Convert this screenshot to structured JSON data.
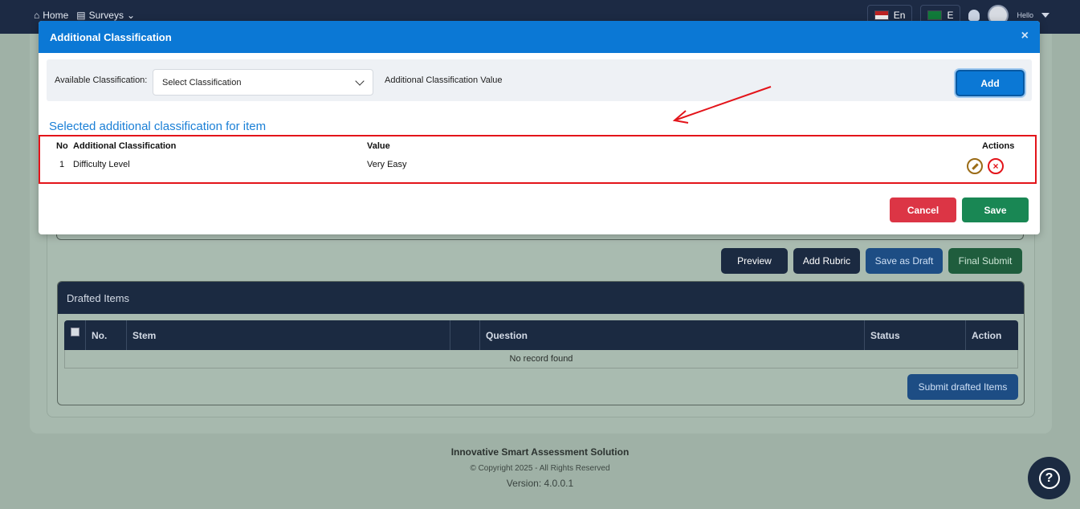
{
  "topbar": {
    "home_label": "Home",
    "surveys_label": "Surveys",
    "lang_label": "En",
    "lang2_label": "E",
    "greeting": "Hello"
  },
  "modal": {
    "title": "Additional Classification",
    "close_glyph": "×",
    "available_label": "Available Classification:",
    "select_value": "Select Classification",
    "value_label": "Additional Classification Value",
    "add_label": "Add",
    "section_title": "Selected additional classification for item",
    "table": {
      "headers": {
        "no": "No",
        "classification": "Additional Classification",
        "value": "Value",
        "actions": "Actions"
      },
      "rows": [
        {
          "no": "1",
          "classification": "Difficulty Level",
          "value": "Very Easy"
        }
      ]
    },
    "cancel_label": "Cancel",
    "save_label": "Save"
  },
  "page": {
    "buttons": {
      "preview": "Preview",
      "add_rubric": "Add Rubric",
      "save_draft": "Save as Draft",
      "final_submit": "Final Submit"
    },
    "drafted": {
      "title": "Drafted Items",
      "columns": [
        "No.",
        "Stem",
        "",
        "Question",
        "Status",
        "Action"
      ],
      "empty_text": "No record found",
      "submit_label": "Submit drafted Items"
    }
  },
  "footer": {
    "brand": "Innovative Smart Assessment Solution",
    "copyright": "© Copyright 2025 - All Rights Reserved",
    "version": "Version: 4.0.0.1"
  },
  "colors": {
    "primary": "#0b78d5",
    "danger": "#dc3545",
    "success": "#198754",
    "annotation": "#e3141a",
    "navy": "#1b2a41"
  }
}
